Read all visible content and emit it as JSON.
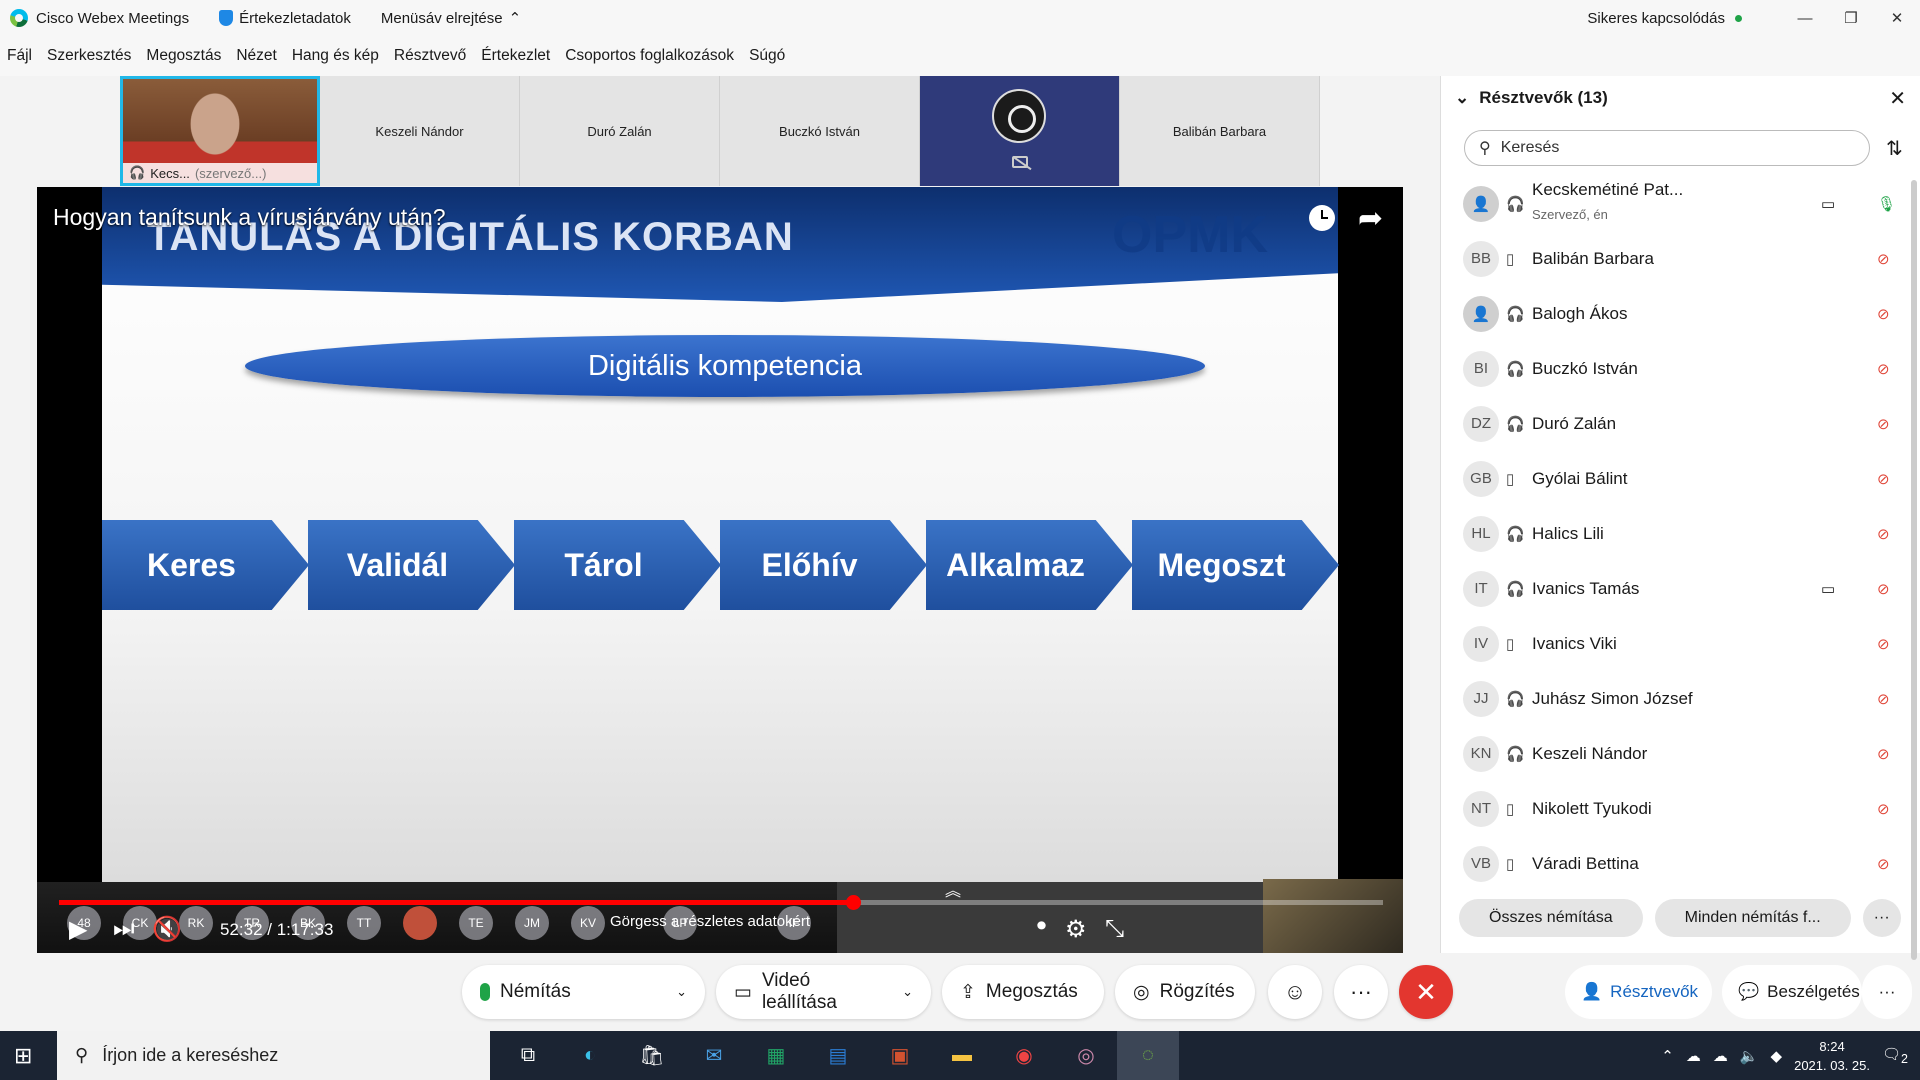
{
  "titlebar": {
    "app_name": "Cisco Webex Meetings",
    "meeting_info": "Értekezletadatok",
    "hide_menu": "Menüsáv elrejtése",
    "status": "Sikeres kapcsolódás"
  },
  "menu": [
    "Fájl",
    "Szerkesztés",
    "Megosztás",
    "Nézet",
    "Hang és kép",
    "Résztvevő",
    "Értekezlet",
    "Csoportos foglalkozások",
    "Súgó"
  ],
  "thumbs": {
    "self_name": "Kecs...",
    "self_role": "(szervező...)",
    "names": [
      "Keszeli Nándor",
      "Duró Zalán",
      "Buczkó István"
    ],
    "last": "Balibán Barbara"
  },
  "video": {
    "title": "Hogyan tanítsunk a vírusjárvány után?",
    "slide_title": "TANULÁS A DIGITÁLIS KORBAN",
    "slide_logo": "OPMK",
    "ellipse_text": "Digitális kompetencia",
    "steps": [
      "Keres",
      "Validál",
      "Tárol",
      "Előhív",
      "Alkalmaz",
      "Megoszt"
    ],
    "time": "52:32 / 1:17:33",
    "progress": 0.6,
    "scroll_hint": "Görgess a részletes adatokért",
    "avatars": [
      "48",
      "CK",
      "RK",
      "TR",
      "BK",
      "TT",
      "",
      "TE",
      "JM",
      "KV",
      "LP",
      "IF"
    ]
  },
  "toolbar": {
    "mute": "Némítás",
    "video": "Videó leállítása",
    "share": "Megosztás",
    "record": "Rögzítés",
    "participants": "Résztvevők",
    "chat": "Beszélgetés"
  },
  "panel": {
    "title": "Résztvevők (13)",
    "search_placeholder": "Keresés",
    "participants": [
      {
        "initials": "",
        "name": "Kecskemétiné Pat...",
        "sub": "Szervező, én",
        "device": "headset",
        "video": true,
        "mic": "on"
      },
      {
        "initials": "BB",
        "name": "Balibán Barbara",
        "sub": "",
        "device": "phone",
        "video": false,
        "mic": "off"
      },
      {
        "initials": "",
        "name": "Balogh Ákos",
        "sub": "",
        "device": "headset",
        "video": false,
        "mic": "off"
      },
      {
        "initials": "BI",
        "name": "Buczkó István",
        "sub": "",
        "device": "headset",
        "video": false,
        "mic": "off"
      },
      {
        "initials": "DZ",
        "name": "Duró Zalán",
        "sub": "",
        "device": "headset",
        "video": false,
        "mic": "off"
      },
      {
        "initials": "GB",
        "name": "Gyólai Bálint",
        "sub": "",
        "device": "phone",
        "video": false,
        "mic": "off"
      },
      {
        "initials": "HL",
        "name": "Halics Lili",
        "sub": "",
        "device": "headset",
        "video": false,
        "mic": "off"
      },
      {
        "initials": "IT",
        "name": "Ivanics Tamás",
        "sub": "",
        "device": "headset",
        "video": true,
        "mic": "off"
      },
      {
        "initials": "IV",
        "name": "Ivanics Viki",
        "sub": "",
        "device": "phone",
        "video": false,
        "mic": "off"
      },
      {
        "initials": "JJ",
        "name": "Juhász Simon József",
        "sub": "",
        "device": "headset",
        "video": false,
        "mic": "off"
      },
      {
        "initials": "KN",
        "name": "Keszeli Nándor",
        "sub": "",
        "device": "headset",
        "video": false,
        "mic": "off"
      },
      {
        "initials": "NT",
        "name": "Nikolett Tyukodi",
        "sub": "",
        "device": "phone",
        "video": false,
        "mic": "off"
      },
      {
        "initials": "VB",
        "name": "Váradi Bettina",
        "sub": "",
        "device": "phone",
        "video": false,
        "mic": "off"
      }
    ],
    "mute_all": "Összes némítása",
    "unmute_all": "Minden némítás f..."
  },
  "taskbar": {
    "search_placeholder": "Írjon ide a kereséshez",
    "time": "8:24",
    "date": "2021. 03. 25.",
    "notif_count": "2"
  }
}
